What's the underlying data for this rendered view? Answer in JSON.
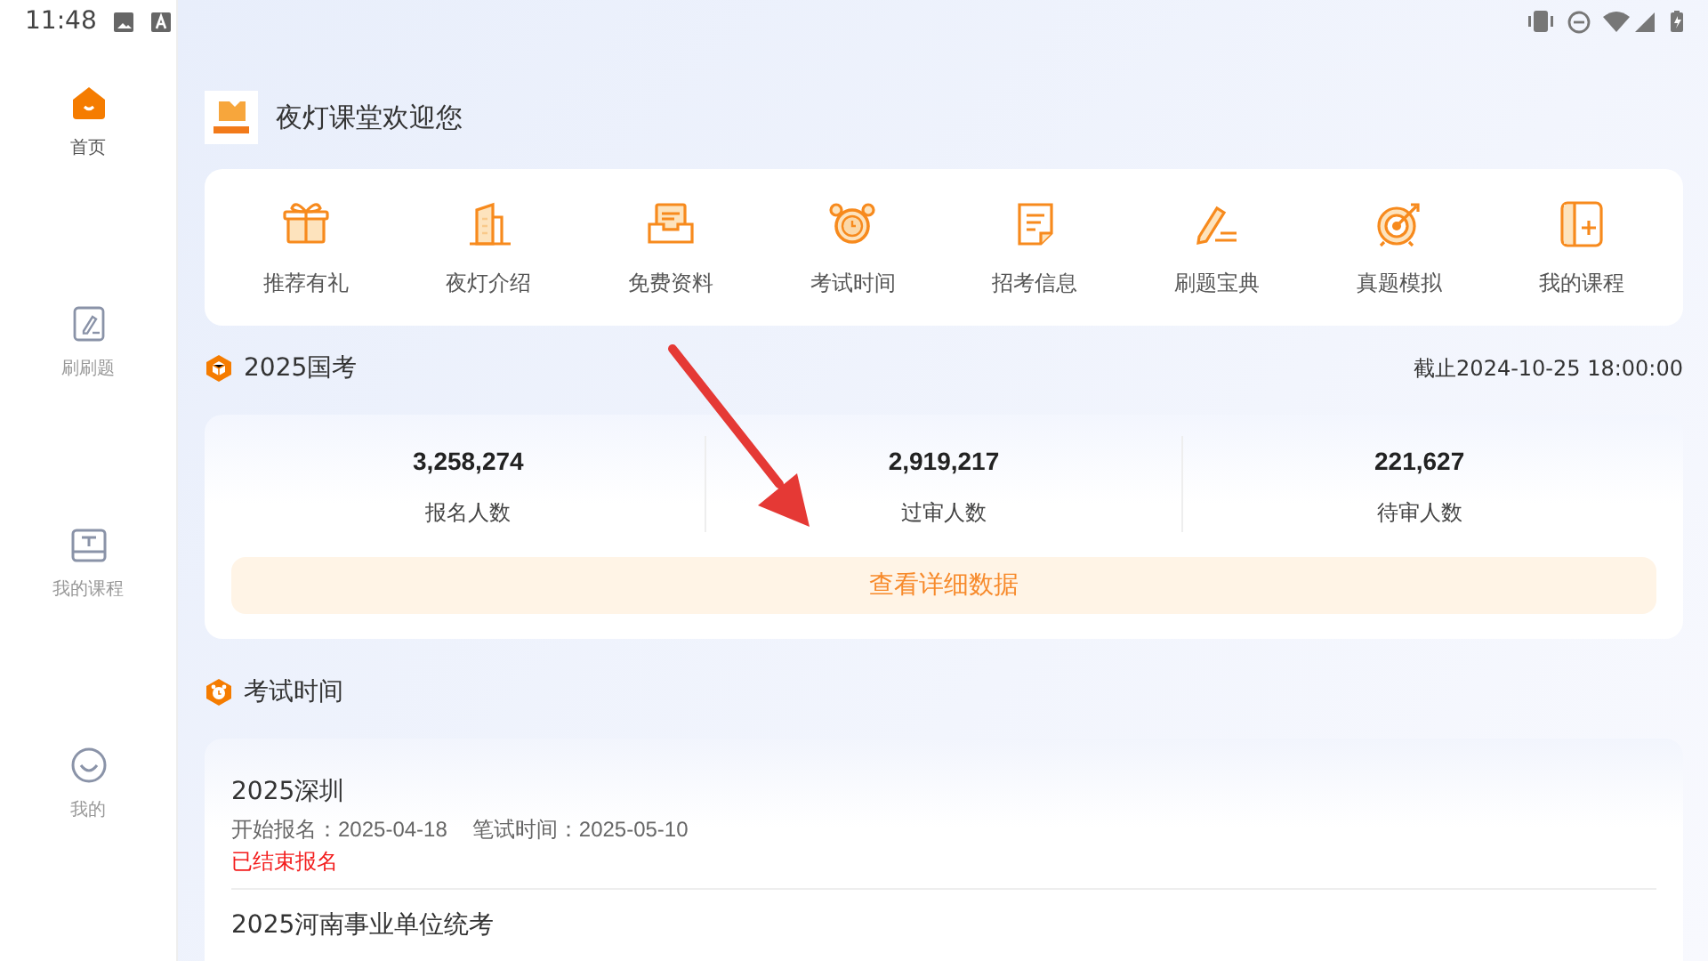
{
  "status_bar": {
    "time": "11:48"
  },
  "sidebar": {
    "items": [
      {
        "label": "首页",
        "kind": "home",
        "selected": true
      },
      {
        "label": "刷刷题",
        "kind": "practice",
        "selected": false
      },
      {
        "label": "我的课程",
        "kind": "course",
        "selected": false
      },
      {
        "label": "我的",
        "kind": "profile",
        "selected": false
      }
    ]
  },
  "header": {
    "title": "夜灯课堂欢迎您"
  },
  "quick_menu": [
    {
      "label": "推荐有礼",
      "kind": "gift"
    },
    {
      "label": "夜灯介绍",
      "kind": "building"
    },
    {
      "label": "免费资料",
      "kind": "tray"
    },
    {
      "label": "考试时间",
      "kind": "clock"
    },
    {
      "label": "招考信息",
      "kind": "document"
    },
    {
      "label": "刷题宝典",
      "kind": "pen"
    },
    {
      "label": "真题模拟",
      "kind": "target"
    },
    {
      "label": "我的课程",
      "kind": "book"
    }
  ],
  "national_exam": {
    "title": "2025国考",
    "deadline": "截止2024-10-25 18:00:00",
    "stats": [
      {
        "value": "3,258,274",
        "label": "报名人数"
      },
      {
        "value": "2,919,217",
        "label": "过审人数"
      },
      {
        "value": "221,627",
        "label": "待审人数"
      }
    ],
    "button": "查看详细数据"
  },
  "exam_schedule": {
    "title": "考试时间",
    "items": [
      {
        "name": "2025深圳",
        "start_label": "开始报名：2025-04-18",
        "exam_label": "笔试时间：2025-05-10",
        "status": "已结束报名",
        "ended": true
      },
      {
        "name": "2025河南事业单位统考"
      }
    ]
  },
  "annotation": {
    "kind": "arrow"
  }
}
